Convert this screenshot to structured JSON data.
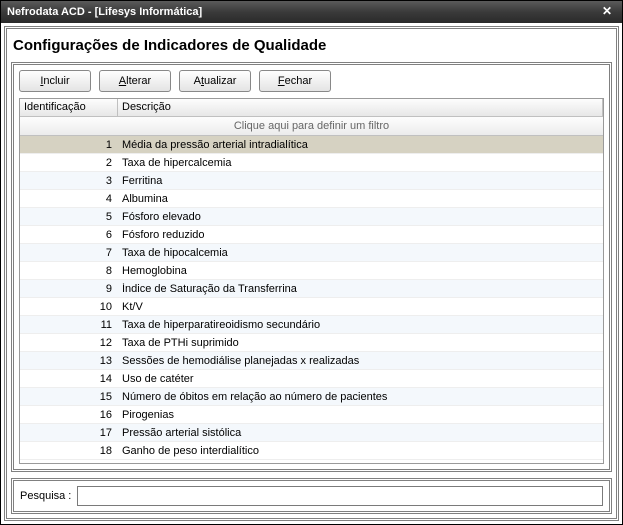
{
  "window": {
    "title": "Nefrodata ACD - [Lifesys Informática]"
  },
  "heading": "Configurações de Indicadores de Qualidade",
  "toolbar": {
    "incluir": "Incluir",
    "alterar": "Alterar",
    "atualizar": "Atualizar",
    "fechar": "Fechar"
  },
  "grid": {
    "columns": {
      "id": "Identificação",
      "desc": "Descrição"
    },
    "filter_hint": "Clique aqui para definir um filtro",
    "rows": [
      {
        "id": "1",
        "desc": "Média da pressão arterial intradialítica",
        "selected": true
      },
      {
        "id": "2",
        "desc": "Taxa de hipercalcemia"
      },
      {
        "id": "3",
        "desc": "Ferritina"
      },
      {
        "id": "4",
        "desc": "Albumina"
      },
      {
        "id": "5",
        "desc": "Fósforo elevado"
      },
      {
        "id": "6",
        "desc": "Fósforo reduzido"
      },
      {
        "id": "7",
        "desc": "Taxa de hipocalcemia"
      },
      {
        "id": "8",
        "desc": "Hemoglobina"
      },
      {
        "id": "9",
        "desc": "Índice de Saturação da Transferrina"
      },
      {
        "id": "10",
        "desc": "Kt/V"
      },
      {
        "id": "11",
        "desc": "Taxa de hiperparatireoidismo secundário"
      },
      {
        "id": "12",
        "desc": "Taxa de PTHi suprimido"
      },
      {
        "id": "13",
        "desc": "Sessões de hemodiálise planejadas x realizadas"
      },
      {
        "id": "14",
        "desc": "Uso de catéter"
      },
      {
        "id": "15",
        "desc": "Número de óbitos em relação ao número de pacientes"
      },
      {
        "id": "16",
        "desc": "Pirogenias"
      },
      {
        "id": "17",
        "desc": "Pressão arterial sistólica"
      },
      {
        "id": "18",
        "desc": "Ganho de peso interdialítico"
      }
    ]
  },
  "search": {
    "label": "Pesquisa :",
    "value": ""
  }
}
